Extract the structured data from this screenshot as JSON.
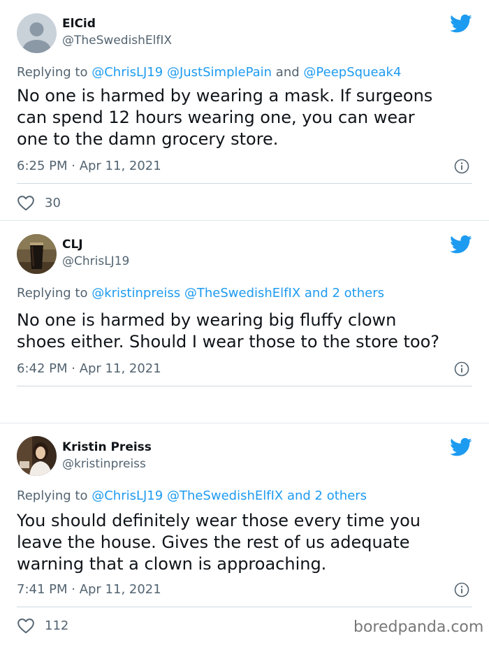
{
  "tweets": [
    {
      "name": "ElCid",
      "handle": "@TheSwedishElfIX",
      "reply": {
        "prefix": "Replying to",
        "mentions": [
          "@ChrisLJ19",
          "@JustSimplePain",
          "and",
          "@PeepSqueak4"
        ]
      },
      "text_lines": [
        "No one is harmed by wearing a mask. If surgeons",
        "can spend 12 hours wearing one, you can wear",
        "one to the damn grocery store."
      ],
      "time": "6:25 PM · Apr 11, 2021",
      "likes": "30",
      "avatar_icon": "default-avatar-icon"
    },
    {
      "name": "CLJ",
      "handle": "@ChrisLJ19",
      "reply": {
        "prefix": "Replying to",
        "mentions": [
          "@kristinpreiss",
          "@TheSwedishElfIX",
          "and 2 others"
        ]
      },
      "text_lines": [
        "No one is harmed by wearing big fluffy clown",
        "shoes either. Should I wear those to the store too?"
      ],
      "time": "6:42 PM · Apr 11, 2021",
      "avatar_icon": "drink-glass-avatar-icon"
    },
    {
      "name": "Kristin Preiss",
      "handle": "@kristinpreiss",
      "reply": {
        "prefix": "Replying to",
        "mentions": [
          "@ChrisLJ19",
          "@TheSwedishElfIX",
          "and 2 others"
        ]
      },
      "text_lines": [
        "You should definitely wear those every time you",
        "leave the house. Gives the rest of us adequate",
        "warning that a clown is approaching."
      ],
      "time": "7:41 PM · Apr 11, 2021",
      "likes": "112",
      "avatar_icon": "person-photo-avatar-icon"
    }
  ],
  "watermark": "boredpanda.com",
  "colors": {
    "twitter_blue": "#1d9bf0",
    "secondary_text": "#536471",
    "primary_text": "#0f1419"
  }
}
